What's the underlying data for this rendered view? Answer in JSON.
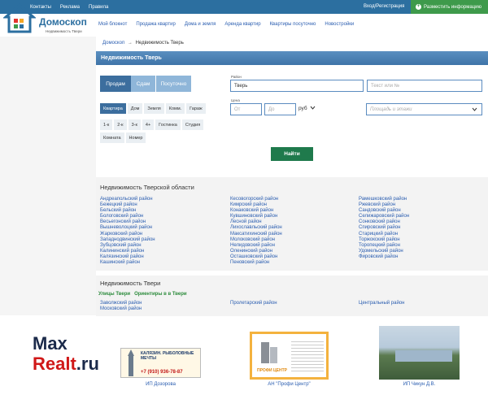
{
  "top_nav": [
    "Контакты",
    "Реклама",
    "Правила"
  ],
  "login_label": "Вход/Регистрация",
  "post_button": "Разместить информацию",
  "logo": {
    "name": "Домоскоп",
    "tagline": "Недвижимость Твери"
  },
  "main_menu": [
    "Мой блокнот",
    "Продажа квартир",
    "Дома и земля",
    "Аренда квартир",
    "Квартиры посуточно",
    "Новостройки"
  ],
  "breadcrumb": {
    "home": "Домоскоп",
    "separator": "→",
    "current": "Недвижимость Тверь"
  },
  "page_title": "Недвижимость Тверь",
  "search": {
    "deal_tabs": [
      "Продам",
      "Сдам",
      "Посуточно"
    ],
    "types": [
      "Квартира",
      "Дом",
      "Земля",
      "Комм.",
      "Гараж"
    ],
    "rooms": [
      "1-к",
      "2-к",
      "3-к",
      "4+",
      "Гостинка",
      "Студия"
    ],
    "extra": [
      "Комната",
      "Номер"
    ],
    "region_label": "Район",
    "region_value": "Тверь",
    "text_placeholder": "Текст или №",
    "price_label": "Цена",
    "price_from_placeholder": "От",
    "price_to_placeholder": "До",
    "currency": "руб",
    "area_placeholder": "Площадь и этажи",
    "find_button": "Найти"
  },
  "regions": {
    "title": "Недвижимость Тверской области",
    "col1": [
      "Андреапольский район",
      "Бежецкий район",
      "Бельский район",
      "Бологовский район",
      "Весьегонский район",
      "Вышневолоцкий район",
      "Жарковский район",
      "Западнодвинский район",
      "Зубцовский район",
      "Калининский район",
      "Калязинский район",
      "Кашинский район"
    ],
    "col2": [
      "Кесовогорский район",
      "Кимрский район",
      "Конаковский район",
      "Кувшиновский район",
      "Лесной район",
      "Лихославльский район",
      "Максатихинский район",
      "Молоковский район",
      "Нелидовский район",
      "Оленинский район",
      "Осташковский район",
      "Пеновский район"
    ],
    "col3": [
      "Рамешковский район",
      "Ржевский район",
      "Сандовский район",
      "Селижаровский район",
      "Сонковский район",
      "Спировский район",
      "Старицкий район",
      "Торжокский район",
      "Торопецкий район",
      "Удомельский район",
      "Фировский район"
    ]
  },
  "tver": {
    "title": "Недвижимость Твери",
    "tabs": [
      "Улицы Твери",
      "Ориентиры в в Твери"
    ],
    "col1": [
      "Заволжский район",
      "Московский район"
    ],
    "col2": [
      "Пролетарский район"
    ],
    "col3": [
      "Центральный район"
    ]
  },
  "watermark": {
    "part1": "Max",
    "part2": "Realt",
    "part3": ".ru"
  },
  "ads": [
    {
      "caption": "ИП Дозорова",
      "text": "КАЛЯЗИН. РЫБОЛОВНЫЕ МЕЧТЫ",
      "phone": "+7 (910) 936-78-87"
    },
    {
      "caption": "АН \"Профи Центр\"",
      "text": "ПРОФИ ЦЕНТР"
    },
    {
      "caption": "ИП Чикун Д.В."
    }
  ],
  "colors": {
    "brand": "#2c6fa0",
    "accent_green": "#3e9a4b",
    "button_green": "#1f7a4c"
  }
}
